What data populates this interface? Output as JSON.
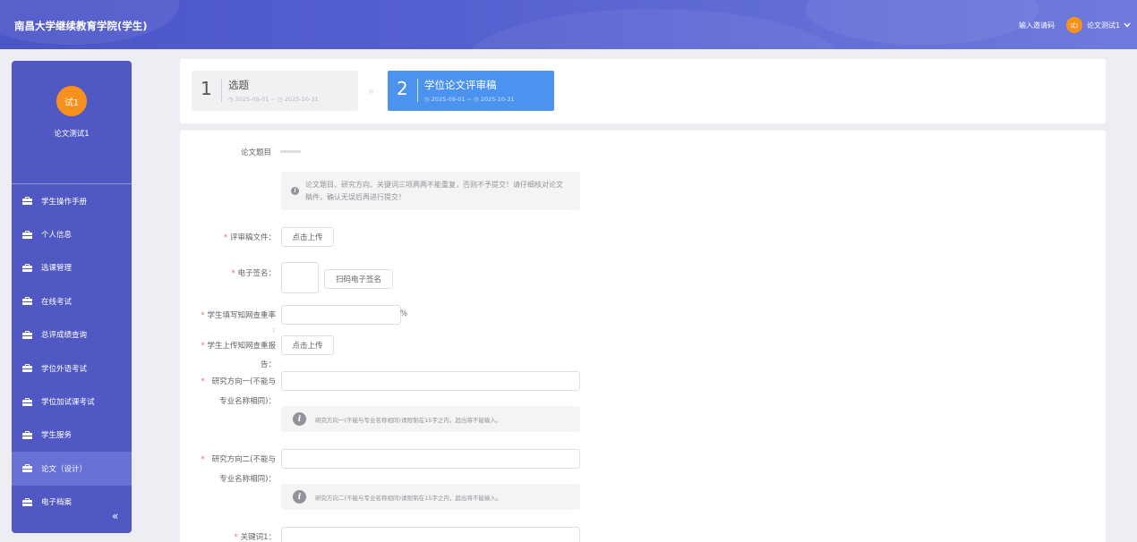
{
  "header": {
    "brand": "南昌大学继续教育学院(学生)",
    "invite_label": "输入邀请码",
    "user_avatar_text": "试1",
    "user_name": "论文测试1",
    "accent_color": "#4a55c8",
    "avatar_color": "#f6911e"
  },
  "sidebar": {
    "avatar_text": "试1",
    "user_name": "论文测试1",
    "items": [
      {
        "label": "学生操作手册"
      },
      {
        "label": "个人信息"
      },
      {
        "label": "选课管理"
      },
      {
        "label": "在线考试"
      },
      {
        "label": "总评成绩查询"
      },
      {
        "label": "学位外语考试"
      },
      {
        "label": "学位加试课考试"
      },
      {
        "label": "学生服务"
      },
      {
        "label": "论文（设计）"
      },
      {
        "label": "电子档案"
      }
    ],
    "active_index": 8,
    "collapse_icon": "«"
  },
  "steps": [
    {
      "number": "1",
      "title": "选题",
      "date": "◷ 2025-09-01 ~ ◷ 2025-10-31",
      "active": false
    },
    {
      "number": "2",
      "title": "学位论文评审稿",
      "date": "◷ 2025-09-01 ~ ◷ 2025-10-31",
      "active": true
    }
  ],
  "step_arrow": "»",
  "form": {
    "title_label": "论文题目",
    "title_notice": "论文题目、研究方向、关键词三项两两不能重复，否则不予提交！请仔细核对论文稿件，确认无误后再进行提交！",
    "review_file_label": "评审稿文件：",
    "upload_button": "点击上传",
    "signature_label": "电子签名：",
    "scan_signature_button": "扫码电子签名",
    "similarity_label_1": "学生填写知网查重率",
    "similarity_label_2": ":",
    "percent_sign": "%",
    "report_label_1": "学生上传知网查重报",
    "report_label_2": "告：",
    "report_upload_button": "点击上传",
    "direction1_label_1": "研究方向一(不能与",
    "direction1_label_2": "专业名称相同)：",
    "direction1_tip": "研究方向一(不能与专业名称相同)请限制在15字之内，超出将不能输入。",
    "direction2_label_1": "研究方向二(不能与",
    "direction2_label_2": "专业名称相同)：",
    "direction2_tip": "研究方向二(不能与专业名称相同)请限制在15字之内，超出将不能输入。",
    "keyword1_label": "关键词1：",
    "required_mark": "*",
    "similarity_value": "",
    "direction1_value": "",
    "direction2_value": "",
    "keyword1_value": ""
  }
}
